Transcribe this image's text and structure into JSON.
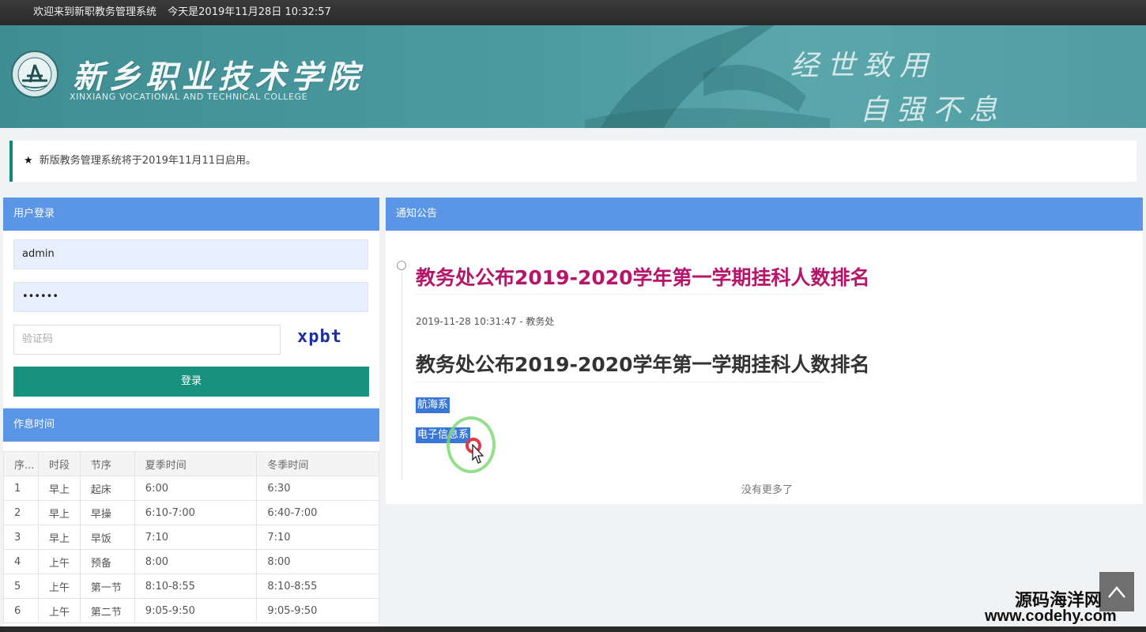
{
  "topbar": {
    "welcome": "欢迎来到新职教务管理系统",
    "today": "今天是2019年11月28日 10:32:57"
  },
  "banner": {
    "school_name": "新乡职业技术学院",
    "school_name_en": "XINXIANG VOCATIONAL AND TECHNICAL COLLEGE",
    "motto_line1": "经世致用",
    "motto_line2": "自强不息"
  },
  "notice": {
    "text": "新版教务管理系统将于2019年11月11日启用。"
  },
  "login": {
    "header": "用户登录",
    "username": "admin",
    "password": "••••••",
    "captcha_placeholder": "验证码",
    "captcha_code": "xpbt",
    "submit_label": "登录"
  },
  "schedule": {
    "header": "作息时间",
    "columns": [
      "序...",
      "时段",
      "节序",
      "夏季时间",
      "冬季时间"
    ],
    "rows": [
      [
        "1",
        "早上",
        "起床",
        "6:00",
        "6:30"
      ],
      [
        "2",
        "早上",
        "早操",
        "6:10-7:00",
        "6:40-7:00"
      ],
      [
        "3",
        "早上",
        "早饭",
        "7:10",
        "7:10"
      ],
      [
        "4",
        "上午",
        "预备",
        "8:00",
        "8:00"
      ],
      [
        "5",
        "上午",
        "第一节",
        "8:10-8:55",
        "8:10-8:55"
      ],
      [
        "6",
        "上午",
        "第二节",
        "9:05-9:50",
        "9:05-9:50"
      ]
    ]
  },
  "news": {
    "header": "通知公告",
    "title": "教务处公布2019-2020学年第一学期挂科人数排名",
    "meta": "2019-11-28 10:31:47 - 教务处",
    "body_title": "教务处公布2019-2020学年第一学期挂科人数排名",
    "departments": [
      "航海系",
      "电子信息系"
    ],
    "no_more": "没有更多了"
  },
  "watermark": {
    "cn": "源码海洋网",
    "url": "www.codehy.com"
  },
  "icons": {
    "star": "star-icon",
    "back_to_top": "chevron-up-icon",
    "logo": "college-logo-icon"
  }
}
